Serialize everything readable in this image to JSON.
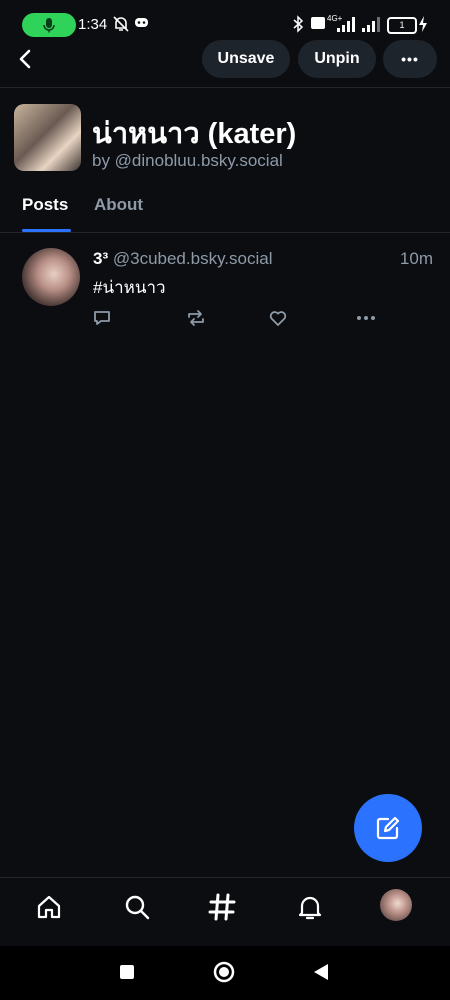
{
  "status_bar": {
    "time": "1:34",
    "battery": "1",
    "network": "4G+"
  },
  "top_nav": {
    "unsave_label": "Unsave",
    "unpin_label": "Unpin",
    "more_label": "•••"
  },
  "feed": {
    "title": "น่าหนาว (kater)",
    "by": "by @dinobluu.bsky.social"
  },
  "tabs": [
    {
      "label": "Posts",
      "active": true
    },
    {
      "label": "About",
      "active": false
    }
  ],
  "post": {
    "author_name": "3³",
    "author_handle": "@3cubed.bsky.social",
    "time": "10m",
    "text": "#น่าหนาว",
    "actions": [
      "reply-icon",
      "repost-icon",
      "like-icon",
      "more-icon"
    ]
  },
  "colors": {
    "background": "#0b0d10",
    "accent": "#2b73ff",
    "muted": "#8e9aa8",
    "mic_pill": "#2fd35a"
  }
}
